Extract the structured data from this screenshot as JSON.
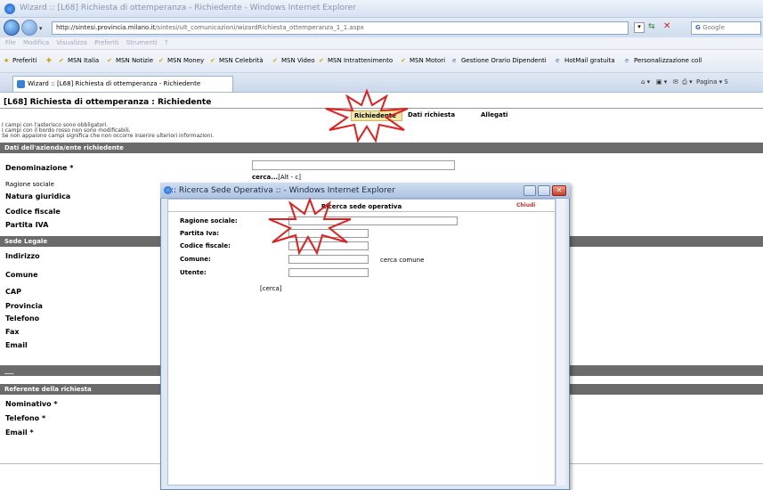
{
  "browser": {
    "window_title": "Wizard :: [L68] Richiesta di ottemperanza - Richiedente - Windows Internet Explorer",
    "address_host": "http://sintesi.provincia.milano.it",
    "address_path": "/sintesi/ult_comunicazioni/wizardRichiesta_ottemperanza_1_1.aspx",
    "search_placeholder": "Google",
    "menu": "File   Modifica   Visualizza   Preferiti   Strumenti   ?",
    "favorites": [
      "Preferiti",
      "MSN Italia",
      "MSN Notizie",
      "MSN Money",
      "MSN Celebrità",
      "MSN Video",
      "MSN Intrattenimento",
      "MSN Motori",
      "Gestione Orario Dipendenti",
      "HotMail gratuita",
      "Personalizzazione coll"
    ],
    "tab_title": "Wizard :: [L68] Richiesta di ottemperanza - Richiedente",
    "tools": "Pagina ▾  S"
  },
  "page": {
    "title": "[L68] Richiesta di ottemperanza : Richiedente",
    "steps": [
      "Richiedente",
      "Dati richiesta",
      "Allegati"
    ],
    "notes": [
      "I campi con l'asterisco sono obbligatori.",
      "I campi con il bordo rosso non sono modificabili.",
      "Se non appaiono campi significa che non occorre inserire ulteriori informazioni."
    ],
    "section_azienda": "Dati dell'azienda/ente richiedente",
    "denominazione": "Denominazione *",
    "cerca_link": "cerca...",
    "cerca_shortcut": "[Alt - c]",
    "ragione_sociale": "Ragione sociale",
    "natura_giuridica": "Natura giuridica",
    "codice_fiscale": "Codice fiscale",
    "partita_iva": "Partita IVA",
    "section_sede": "Sede Legale",
    "indirizzo": "Indirizzo",
    "comune": "Comune",
    "cap": "CAP",
    "provincia": "Provincia",
    "telefono": "Telefono",
    "fax": "Fax",
    "email": "Email",
    "section_blank": "___",
    "section_referente": "Referente della richiesta",
    "nominativo": "Nominativo *",
    "telefono_ref": "Telefono *",
    "email_ref": "Email *"
  },
  "popup": {
    "title": ":: Ricerca Sede Operativa :: - Windows Internet Explorer",
    "heading": "Ricerca sede operativa",
    "close_label": "Chiudi",
    "fields": {
      "ragione_sociale": "Ragione sociale:",
      "partita_iva": "Partita Iva:",
      "codice_fiscale": "Codice fiscale:",
      "comune": "Comune:",
      "utente": "Utente:"
    },
    "cerca_comune": "cerca comune",
    "cerca_button": "[cerca]"
  },
  "colors": {
    "section_bg": "#6b6b6b",
    "highlight_star": "#e0201e",
    "active_step": "#f0e6a8"
  }
}
